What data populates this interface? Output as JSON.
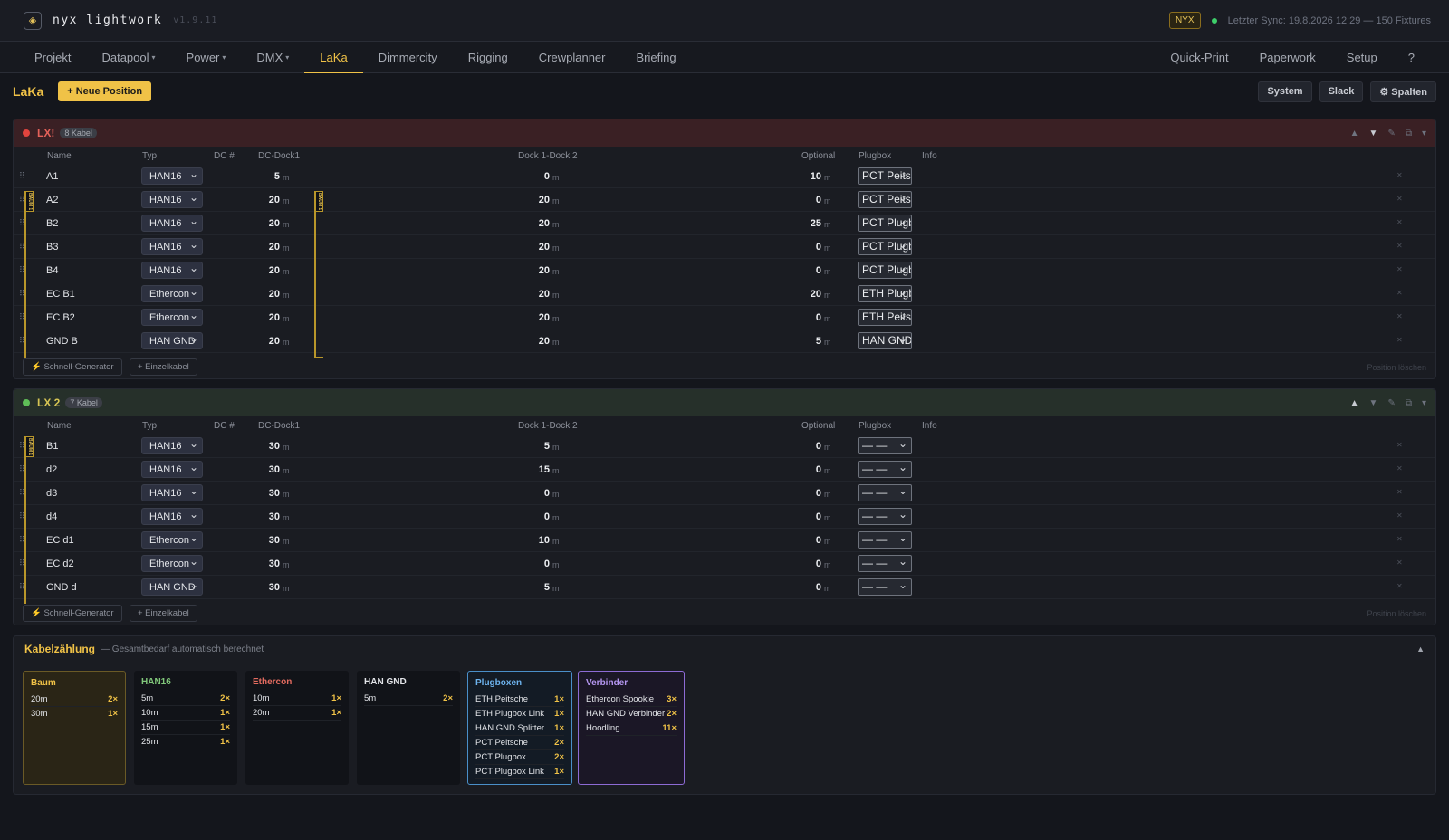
{
  "app": {
    "name": "nyx lightwork",
    "version": "v1.9.11",
    "badge": "NYX",
    "sync": "Letzter Sync: 19.8.2026 12:29 — 150 Fixtures"
  },
  "nav": {
    "left": [
      {
        "label": "Projekt",
        "caret": false
      },
      {
        "label": "Datapool",
        "caret": true
      },
      {
        "label": "Power",
        "caret": true
      },
      {
        "label": "DMX",
        "caret": true
      },
      {
        "label": "LaKa",
        "caret": false,
        "active": true
      },
      {
        "label": "Dimmercity",
        "caret": false
      },
      {
        "label": "Rigging",
        "caret": false
      },
      {
        "label": "Crewplanner",
        "caret": false
      },
      {
        "label": "Briefing",
        "caret": false
      }
    ],
    "right": [
      "Quick-Print",
      "Paperwork",
      "Setup",
      "?"
    ]
  },
  "page": {
    "title": "LaKa",
    "new_position": "+ Neue Position",
    "btn_system": "System",
    "btn_slack": "Slack",
    "btn_columns": "⚙ Spalten"
  },
  "columns": {
    "name": "Name",
    "typ": "Typ",
    "dc": "DC #",
    "dock1": "DC-Dock1",
    "dock12": "Dock 1-Dock 2",
    "optional": "Optional",
    "plugbox": "Plugbox",
    "info": "Info"
  },
  "unit": "m",
  "tree_label": "BAUM 1",
  "footer": {
    "generator": "⚡ Schnell-Generator",
    "single": "+ Einzelkabel",
    "delete": "Position löschen"
  },
  "sections": [
    {
      "name": "LX!",
      "count": "8 Kabel",
      "color": "red",
      "rows": [
        {
          "name": "A1",
          "typ": "HAN16",
          "d1": "5",
          "d12": "0",
          "opt": "10",
          "plug": "PCT Peitsche"
        },
        {
          "name": "A2",
          "typ": "HAN16",
          "d1": "20",
          "d12": "20",
          "opt": "0",
          "plug": "PCT Peitsche"
        },
        {
          "name": "B2",
          "typ": "HAN16",
          "d1": "20",
          "d12": "20",
          "opt": "25",
          "plug": "PCT Plugbox"
        },
        {
          "name": "B3",
          "typ": "HAN16",
          "d1": "20",
          "d12": "20",
          "opt": "0",
          "plug": "PCT Plugbox"
        },
        {
          "name": "B4",
          "typ": "HAN16",
          "d1": "20",
          "d12": "20",
          "opt": "0",
          "plug": "PCT Plugbox"
        },
        {
          "name": "EC B1",
          "typ": "Ethercon",
          "d1": "20",
          "d12": "20",
          "opt": "20",
          "plug": "ETH Plugbox"
        },
        {
          "name": "EC B2",
          "typ": "Ethercon",
          "d1": "20",
          "d12": "20",
          "opt": "0",
          "plug": "ETH Peitsche"
        },
        {
          "name": "GND B",
          "typ": "HAN GND",
          "d1": "20",
          "d12": "20",
          "opt": "5",
          "plug": "HAN GND"
        }
      ]
    },
    {
      "name": "LX 2",
      "count": "7 Kabel",
      "color": "green",
      "rows": [
        {
          "name": "B1",
          "typ": "HAN16",
          "d1": "30",
          "d12": "5",
          "opt": "0",
          "plug": "— —"
        },
        {
          "name": "d2",
          "typ": "HAN16",
          "d1": "30",
          "d12": "15",
          "opt": "0",
          "plug": "— —"
        },
        {
          "name": "d3",
          "typ": "HAN16",
          "d1": "30",
          "d12": "0",
          "opt": "0",
          "plug": "— —"
        },
        {
          "name": "d4",
          "typ": "HAN16",
          "d1": "30",
          "d12": "0",
          "opt": "0",
          "plug": "— —"
        },
        {
          "name": "EC d1",
          "typ": "Ethercon",
          "d1": "30",
          "d12": "10",
          "opt": "0",
          "plug": "— —"
        },
        {
          "name": "EC d2",
          "typ": "Ethercon",
          "d1": "30",
          "d12": "0",
          "opt": "0",
          "plug": "— —"
        },
        {
          "name": "GND d",
          "typ": "HAN GND",
          "d1": "30",
          "d12": "5",
          "opt": "0",
          "plug": "— —"
        }
      ]
    }
  ],
  "summary": {
    "title": "Kabelzählung",
    "subtitle": "— Gesamtbedarf automatisch berechnet",
    "cards": [
      {
        "title": "Baum",
        "kind": "baum",
        "items": [
          [
            "20m",
            "2×"
          ],
          [
            "30m",
            "1×"
          ]
        ]
      },
      {
        "title": "HAN16",
        "kind": "han",
        "items": [
          [
            "5m",
            "2×"
          ],
          [
            "10m",
            "1×"
          ],
          [
            "15m",
            "1×"
          ],
          [
            "25m",
            "1×"
          ]
        ]
      },
      {
        "title": "Ethercon",
        "kind": "eth",
        "items": [
          [
            "10m",
            "1×"
          ],
          [
            "20m",
            "1×"
          ]
        ]
      },
      {
        "title": "HAN GND",
        "kind": "gnd",
        "items": [
          [
            "5m",
            "2×"
          ]
        ]
      },
      {
        "title": "Plugboxen",
        "kind": "plug",
        "items": [
          [
            "ETH Peitsche",
            "1×"
          ],
          [
            "ETH Plugbox Link",
            "1×"
          ],
          [
            "HAN GND Splitter",
            "1×"
          ],
          [
            "PCT Peitsche",
            "2×"
          ],
          [
            "PCT Plugbox",
            "2×"
          ],
          [
            "PCT Plugbox Link",
            "1×"
          ]
        ]
      },
      {
        "title": "Verbinder",
        "kind": "verb",
        "items": [
          [
            "Ethercon Spookie",
            "3×"
          ],
          [
            "HAN GND Verbinder",
            "2×"
          ],
          [
            "Hoodling",
            "11×"
          ]
        ]
      }
    ]
  }
}
